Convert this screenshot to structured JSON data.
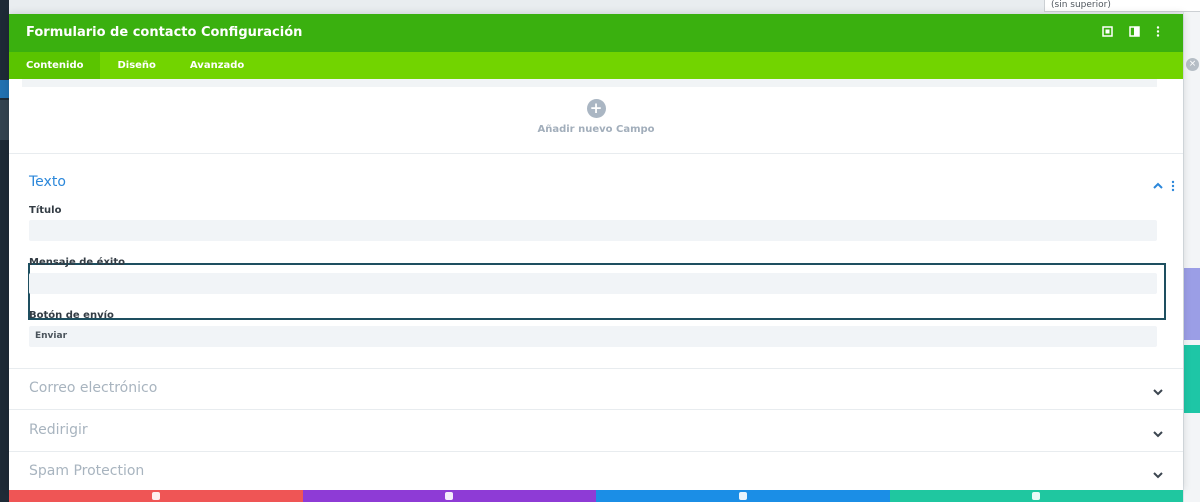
{
  "background": {
    "right_dropdown_text": "(sin superior)"
  },
  "modal": {
    "title": "Formulario de contacto Configuración",
    "tabs": [
      {
        "label": "Contenido",
        "active": true
      },
      {
        "label": "Diseño",
        "active": false
      },
      {
        "label": "Avanzado",
        "active": false
      }
    ],
    "add_field_label": "Añadir nuevo Campo",
    "sections": {
      "texto": {
        "title": "Texto",
        "fields": [
          {
            "label": "Título",
            "value": ""
          },
          {
            "label": "Mensaje de éxito",
            "value": ""
          },
          {
            "label": "Botón de envío",
            "value": "Enviar"
          }
        ]
      },
      "collapsed": [
        {
          "title": "Correo electrónico"
        },
        {
          "title": "Redirigir"
        },
        {
          "title": "Spam Protection"
        }
      ]
    }
  },
  "colors": {
    "header": "#3ab00f",
    "tabs": "#72d400",
    "active_section": "#2b87da",
    "bottom_bar": [
      "#ef5555",
      "#8e3bd6",
      "#1b8ee6",
      "#1fc7a0"
    ]
  },
  "icons": [
    "expand-icon",
    "columns-icon",
    "more-options-icon",
    "plus-icon",
    "chevron-up-icon",
    "chevron-down-icon"
  ]
}
